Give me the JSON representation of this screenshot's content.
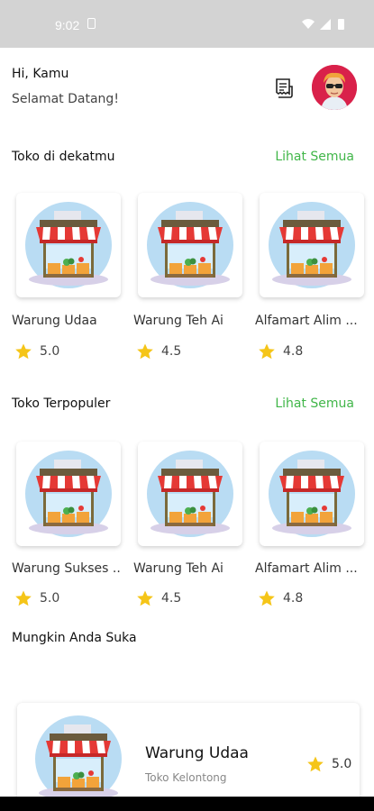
{
  "status_bar": {
    "time": "9:02"
  },
  "header": {
    "greeting": "Hi, Kamu",
    "subtitle": "Selamat Datang!"
  },
  "sections": {
    "nearby": {
      "title": "Toko di dekatmu",
      "see_all": "Lihat Semua",
      "items": [
        {
          "name": "Warung Udaa",
          "rating": "5.0"
        },
        {
          "name": "Warung Teh Ai",
          "rating": "4.5"
        },
        {
          "name": "Alfamart Alim ...",
          "rating": "4.8"
        }
      ]
    },
    "popular": {
      "title": "Toko Terpopuler",
      "see_all": "Lihat Semua",
      "items": [
        {
          "name": "Warung Sukses ...",
          "rating": "5.0"
        },
        {
          "name": "Warung Teh Ai",
          "rating": "4.5"
        },
        {
          "name": "Alfamart Alim ...",
          "rating": "4.8"
        }
      ]
    },
    "recommended": {
      "title": "Mungkin Anda Suka",
      "items": [
        {
          "name": "Warung Udaa",
          "category": "Toko Kelontong",
          "rating": "5.0"
        }
      ]
    }
  },
  "colors": {
    "accent": "#41b649",
    "avatar_bg": "#d9214a",
    "star": "#f5c518",
    "status_bar": "#d3d3d3"
  }
}
